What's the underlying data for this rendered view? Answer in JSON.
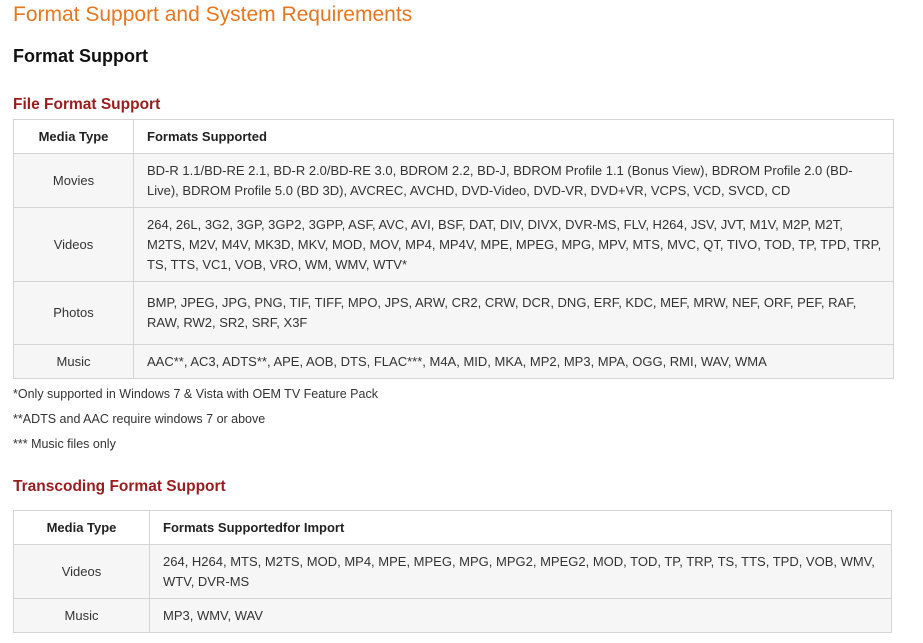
{
  "page": {
    "title": "Format Support and System Requirements",
    "section_title": "Format Support"
  },
  "file_format": {
    "title": "File Format Support",
    "headers": {
      "media_type": "Media Type",
      "formats": "Formats Supported"
    },
    "rows": [
      {
        "type": "Movies",
        "formats": "BD-R 1.1/BD-RE 2.1, BD-R 2.0/BD-RE 3.0, BDROM 2.2, BD-J, BDROM Profile 1.1 (Bonus View), BDROM Profile 2.0 (BD-Live), BDROM Profile 5.0 (BD 3D), AVCREC, AVCHD, DVD-Video, DVD-VR, DVD+VR, VCPS, VCD, SVCD, CD"
      },
      {
        "type": "Videos",
        "formats": "264, 26L, 3G2, 3GP, 3GP2, 3GPP, ASF, AVC, AVI, BSF, DAT, DIV, DIVX, DVR-MS, FLV, H264, JSV, JVT, M1V, M2P, M2T, M2TS, M2V, M4V, MK3D, MKV, MOD, MOV, MP4, MP4V, MPE, MPEG, MPG, MPV, MTS, MVC, QT, TIVO, TOD, TP, TPD, TRP, TS, TTS, VC1, VOB, VRO, WM, WMV, WTV*"
      },
      {
        "type": "Photos",
        "formats": "BMP, JPEG, JPG, PNG, TIF, TIFF, MPO, JPS, ARW, CR2, CRW, DCR, DNG, ERF, KDC, MEF, MRW, NEF, ORF, PEF, RAF, RAW, RW2, SR2, SRF, X3F"
      },
      {
        "type": "Music",
        "formats": "AAC**, AC3, ADTS**, APE, AOB, DTS, FLAC***, M4A, MID, MKA, MP2, MP3, MPA, OGG, RMI, WAV, WMA"
      }
    ],
    "notes": [
      "*Only supported in Windows 7 & Vista with OEM TV Feature Pack",
      "**ADTS and AAC require windows 7 or above",
      "*** Music files only"
    ]
  },
  "transcoding": {
    "title": "Transcoding Format Support",
    "headers": {
      "media_type": "Media Type",
      "formats": "Formats Supportedfor Import"
    },
    "rows": [
      {
        "type": "Videos",
        "formats": "264, H264, MTS, M2TS, MOD, MP4, MPE, MPEG, MPG, MPG2, MPEG2, MOD, TOD, TP, TRP, TS, TTS, TPD, VOB, WMV, WTV, DVR-MS"
      },
      {
        "type": "Music",
        "formats": "MP3, WMV, WAV"
      }
    ]
  },
  "colors": {
    "page_title": "#e8761f",
    "sub_title": "#9b1c1c",
    "border": "#d4d4d4",
    "cell_bg": "#f6f6f6"
  }
}
